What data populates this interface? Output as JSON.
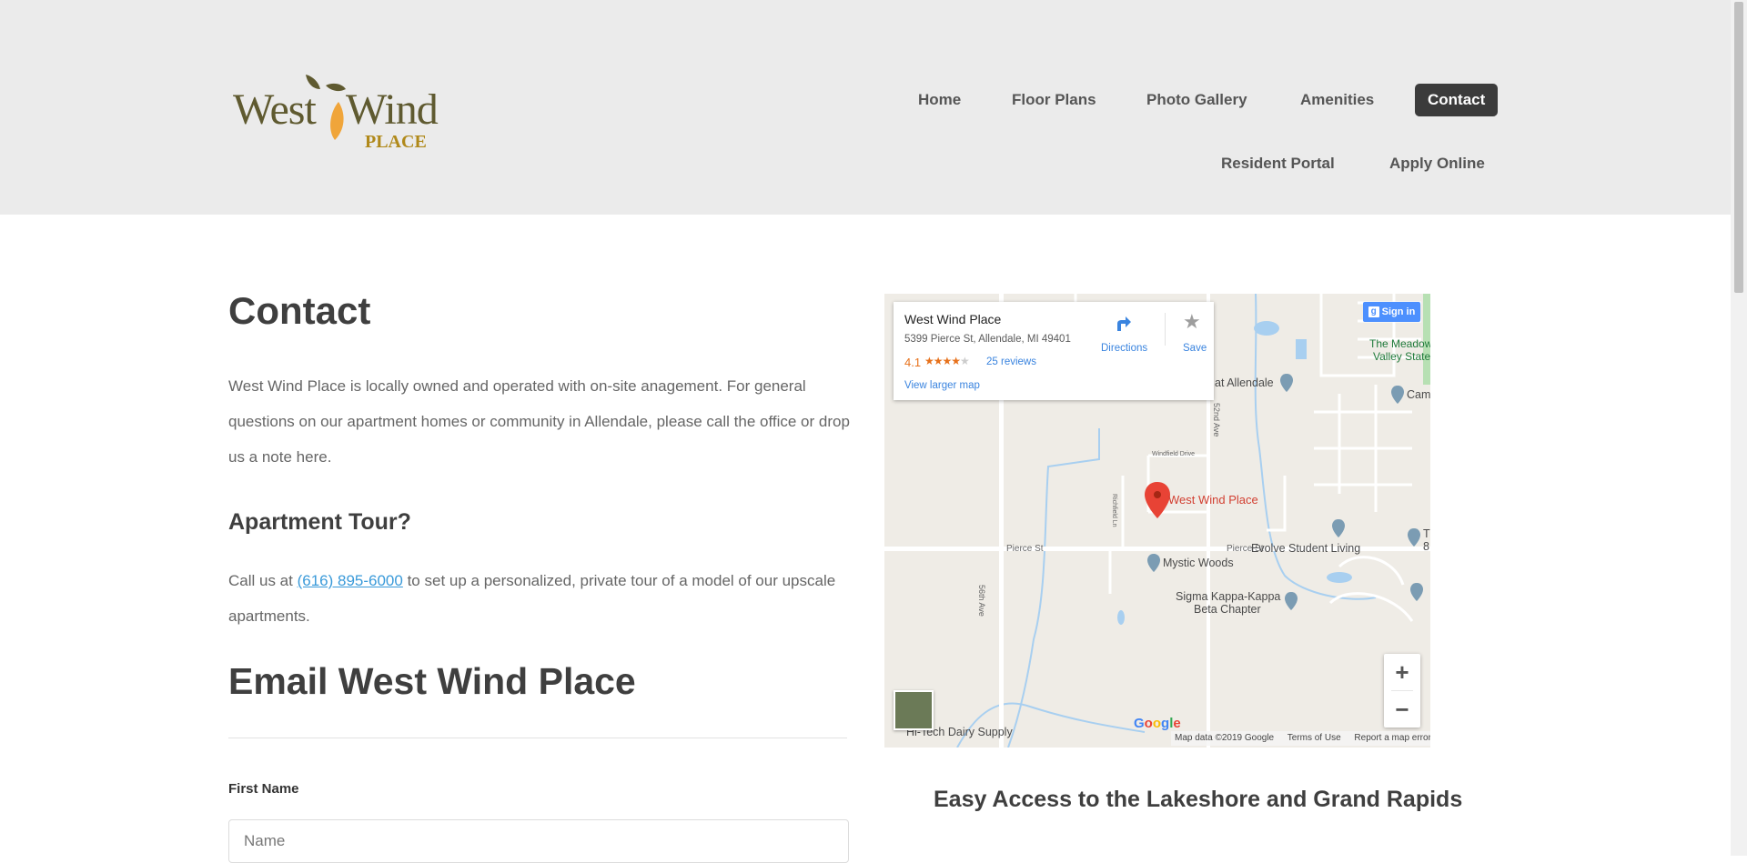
{
  "brand": {
    "logo_word_1": "West",
    "logo_word_2": "Wind",
    "logo_word_3": "PLACE",
    "logo_colors": {
      "text": "#5f5a30",
      "leaf_orange": "#f0a53a",
      "leaf_green": "#5f5a30",
      "place": "#b0891a"
    }
  },
  "nav": {
    "items": [
      {
        "label": "Home"
      },
      {
        "label": "Floor Plans"
      },
      {
        "label": "Photo Gallery"
      },
      {
        "label": "Amenities"
      },
      {
        "label": "Contact",
        "active": true
      },
      {
        "label": "Resident Portal"
      },
      {
        "label": "Apply Online"
      }
    ]
  },
  "content": {
    "title": "Contact",
    "intro": "West Wind Place is locally owned and operated with on-site anagement. For general questions on our apartment homes or community in Allendale, please call the office or drop us a note here.",
    "tour_heading": "Apartment Tour?",
    "tour_prefix": "Call us at ",
    "tour_phone": "(616) 895-6000",
    "tour_suffix": " to set up a personalized, private tour of a model of our upscale apartments.",
    "email_heading": "Email West Wind Place",
    "form": {
      "first_name_label": "First Name",
      "first_name_placeholder": "Name",
      "first_name_value": ""
    },
    "access_heading": "Easy Access to the Lakeshore and Grand Rapids"
  },
  "map": {
    "card": {
      "title": "West Wind Place",
      "address": "5399 Pierce St, Allendale, MI 49401",
      "rating": "4.1",
      "stars_filled": "★★★★",
      "stars_empty": "★",
      "reviews": "25 reviews",
      "larger_map": "View larger map",
      "directions": "Directions",
      "save": "Save"
    },
    "signin": "Sign in",
    "labels": {
      "west_wind": "West Wind Place",
      "mystic_woods": "Mystic Woods",
      "sigma_1": "Sigma Kappa-Kappa",
      "sigma_2": "Beta Chapter",
      "evolve": "Evolve Student Living",
      "allendale": "at Allendale",
      "meadows_1": "The Meadow",
      "meadows_2": "Valley State",
      "cam": "Cam",
      "pierce_1": "Pierce St",
      "pierce_2": "Pierce St",
      "ave56": "56th Ave",
      "ave52": "52nd Ave",
      "windfield": "Windfield Drive",
      "richfield": "Richfield Ln",
      "hitech": "Hi-Tech Dairy Supply",
      "t_right": "T",
      "eight_right": "8"
    },
    "zoom_in": "+",
    "zoom_out": "−",
    "google": [
      "G",
      "o",
      "o",
      "g",
      "l",
      "e"
    ],
    "footer": {
      "data": "Map data ©2019 Google",
      "terms": "Terms of Use",
      "report": "Report a map error"
    },
    "colors": {
      "land": "#efece6",
      "road": "#ffffff",
      "water": "#a8cff0",
      "pin": "#e84335",
      "poi": "#7b9cb3"
    }
  }
}
